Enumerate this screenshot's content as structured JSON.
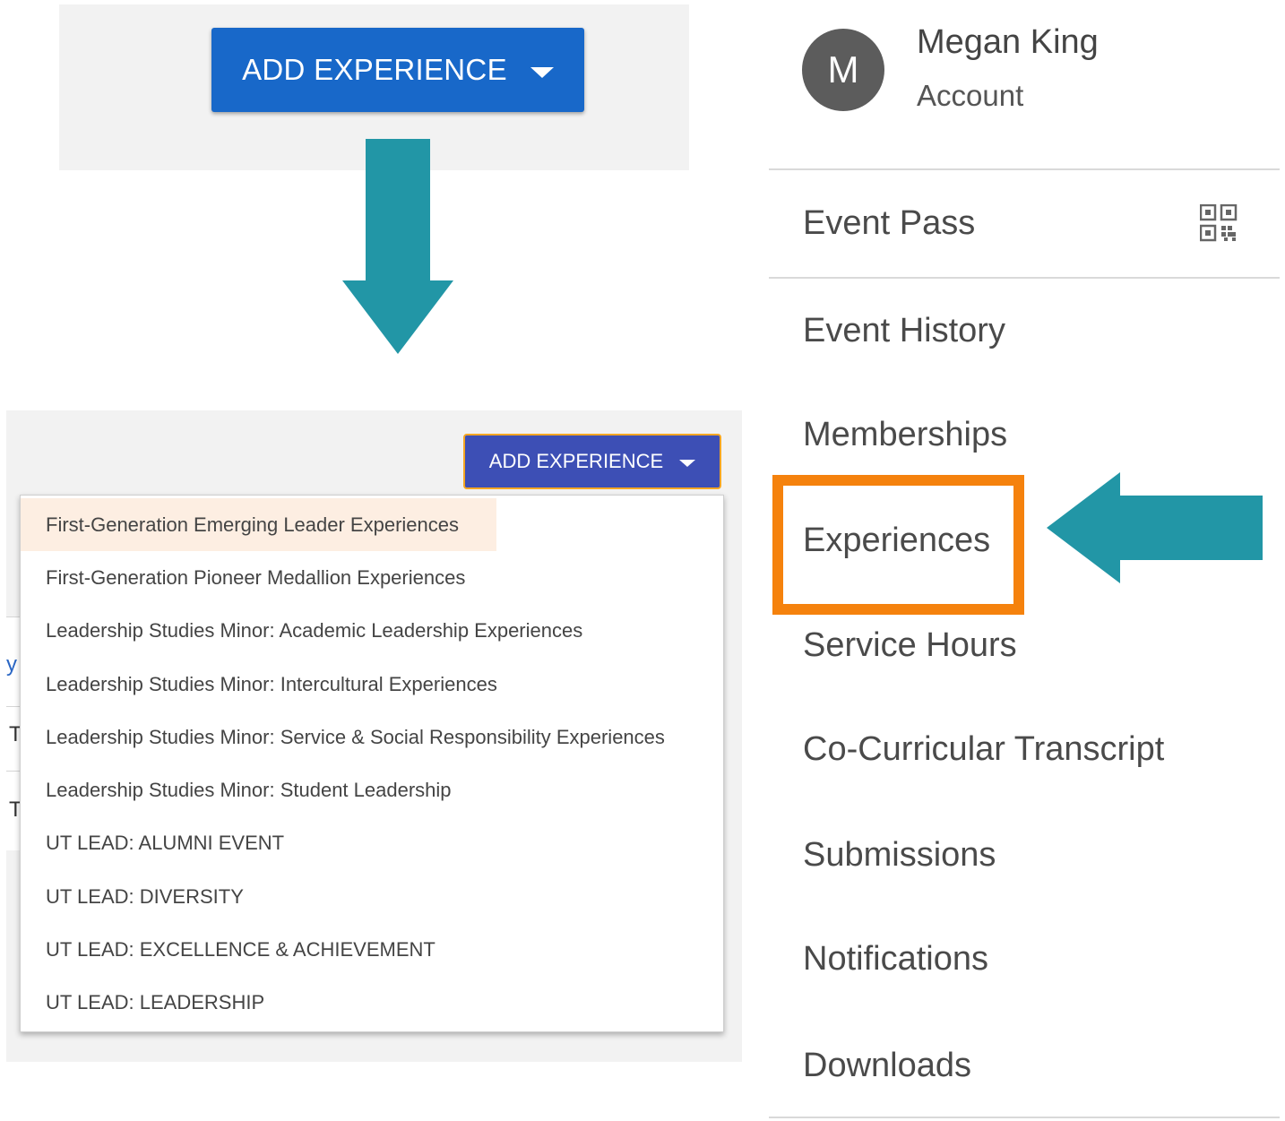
{
  "top_panel": {
    "add_experience_label": "ADD EXPERIENCE"
  },
  "bottom_panel": {
    "add_experience_label": "ADD EXPERIENCE",
    "background_fragments": [
      "y",
      "T",
      "T"
    ],
    "dropdown_items": [
      "First-Generation Emerging Leader Experiences",
      "First-Generation Pioneer Medallion Experiences",
      "Leadership Studies Minor: Academic Leadership Experiences",
      "Leadership Studies Minor: Intercultural Experiences",
      "Leadership Studies Minor: Service & Social Responsibility Experiences",
      "Leadership Studies Minor: Student Leadership",
      "UT LEAD: ALUMNI EVENT",
      "UT LEAD: DIVERSITY",
      "UT LEAD: EXCELLENCE & ACHIEVEMENT",
      "UT LEAD: LEADERSHIP"
    ]
  },
  "account": {
    "avatar_initial": "M",
    "name": "Megan King",
    "account_label": "Account"
  },
  "menu": {
    "event_pass": "Event Pass",
    "event_history": "Event History",
    "memberships": "Memberships",
    "experiences": "Experiences",
    "service_hours": "Service Hours",
    "co_curricular_transcript": "Co-Curricular Transcript",
    "submissions": "Submissions",
    "notifications": "Notifications",
    "downloads": "Downloads",
    "event_pass_icon": "qr-code-icon"
  },
  "colors": {
    "button_blue": "#1868c9",
    "button_indigo": "#3d4fb5",
    "focus_outline": "#f5a623",
    "arrow_teal": "#2296a6",
    "highlight_orange": "#f5820d",
    "dropdown_hover": "#fdeee2"
  }
}
